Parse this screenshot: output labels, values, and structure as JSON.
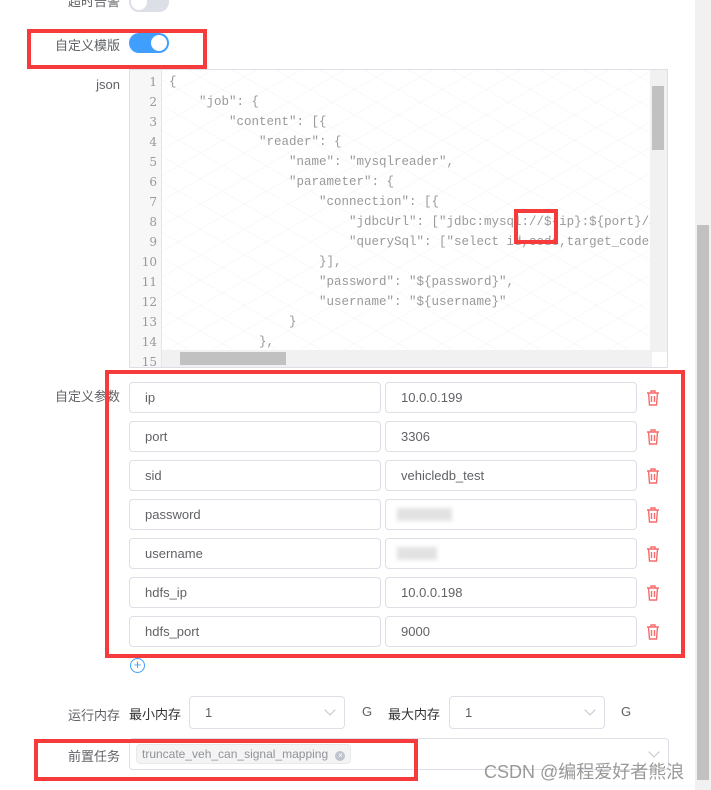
{
  "form": {
    "timeout_alarm_label": "超时告警",
    "timeout_alarm_on": false,
    "custom_template_label": "自定义模版",
    "custom_template_on": true,
    "json_label": "json",
    "json_lines": [
      "{",
      "    \"job\": {",
      "        \"content\": [{",
      "            \"reader\": {",
      "                \"name\": \"mysqlreader\",",
      "                \"parameter\": {",
      "                    \"connection\": [{",
      "                        \"jdbcUrl\": [\"jdbc:mysql://${ip}:${port}/${sid",
      "                        \"querySql\": [\"select id,code,target_code,vers",
      "                    }],",
      "                    \"password\": \"${password}\",",
      "                    \"username\": \"${username}\"",
      "                }",
      "            },",
      ""
    ],
    "custom_params_label": "自定义参数",
    "params": [
      {
        "key": "ip",
        "value": "10.0.0.199"
      },
      {
        "key": "port",
        "value": "3306"
      },
      {
        "key": "sid",
        "value": "vehicledb_test"
      },
      {
        "key": "password",
        "value": "",
        "blurred": true
      },
      {
        "key": "username",
        "value": "",
        "blurred": true
      },
      {
        "key": "hdfs_ip",
        "value": "10.0.0.198"
      },
      {
        "key": "hdfs_port",
        "value": "9000"
      }
    ],
    "memory_label": "运行内存",
    "min_memory_label": "最小内存",
    "min_memory_value": "1",
    "max_memory_label": "最大内存",
    "max_memory_value": "1",
    "unit": "G",
    "pre_task_label": "前置任务",
    "pre_task_tags": [
      "truncate_veh_can_signal_mapping"
    ]
  },
  "watermark": "CSDN @编程爱好者熊浪",
  "colors": {
    "accent": "#409eff",
    "danger": "#f56c6c",
    "annotation": "#f53b3b"
  }
}
